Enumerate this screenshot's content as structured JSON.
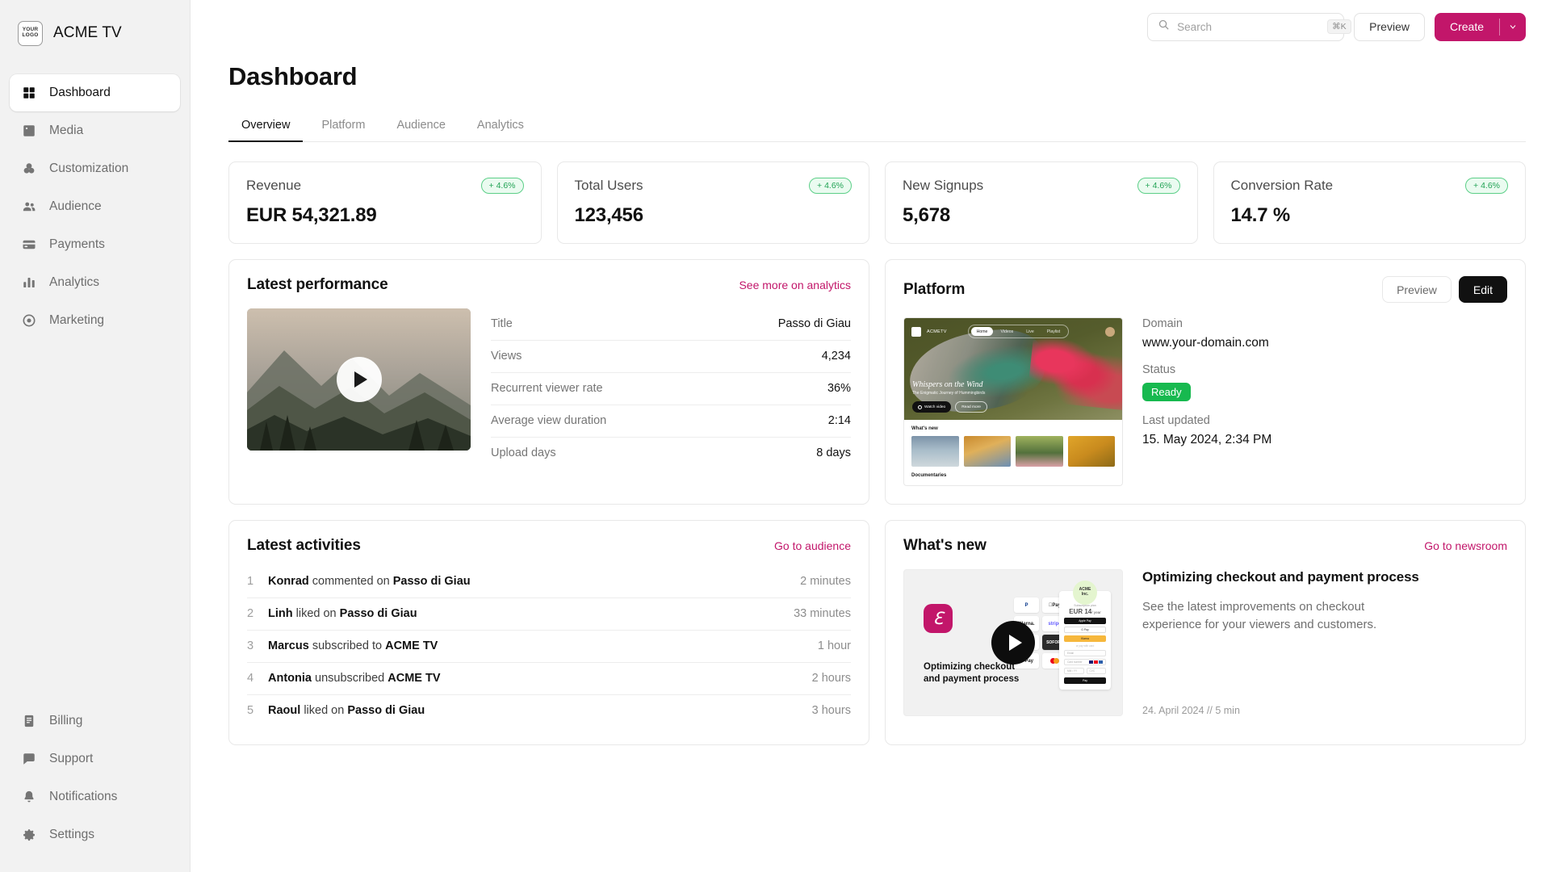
{
  "brand": {
    "logo_line1": "YOUR",
    "logo_line2": "LOGO",
    "name": "ACME TV"
  },
  "sidebar": {
    "primary": [
      {
        "label": "Dashboard",
        "icon": "grid-icon",
        "active": true
      },
      {
        "label": "Media",
        "icon": "image-icon",
        "active": false
      },
      {
        "label": "Customization",
        "icon": "palette-icon",
        "active": false
      },
      {
        "label": "Audience",
        "icon": "people-icon",
        "active": false
      },
      {
        "label": "Payments",
        "icon": "credit-card-icon",
        "active": false
      },
      {
        "label": "Analytics",
        "icon": "bar-chart-icon",
        "active": false
      },
      {
        "label": "Marketing",
        "icon": "target-icon",
        "active": false
      }
    ],
    "secondary": [
      {
        "label": "Billing",
        "icon": "document-icon"
      },
      {
        "label": "Support",
        "icon": "chat-icon"
      },
      {
        "label": "Notifications",
        "icon": "bell-icon"
      },
      {
        "label": "Settings",
        "icon": "gear-icon"
      }
    ]
  },
  "topbar": {
    "search_placeholder": "Search",
    "search_value": "",
    "search_shortcut": "⌘K",
    "preview_label": "Preview",
    "create_label": "Create"
  },
  "page": {
    "title": "Dashboard"
  },
  "tabs": [
    {
      "label": "Overview",
      "active": true
    },
    {
      "label": "Platform",
      "active": false
    },
    {
      "label": "Audience",
      "active": false
    },
    {
      "label": "Analytics",
      "active": false
    }
  ],
  "kpis": [
    {
      "label": "Revenue",
      "value": "EUR 54,321.89",
      "delta": "+ 4.6%"
    },
    {
      "label": "Total Users",
      "value": "123,456",
      "delta": "+ 4.6%"
    },
    {
      "label": "New Signups",
      "value": "5,678",
      "delta": "+ 4.6%"
    },
    {
      "label": "Conversion Rate",
      "value": "14.7 %",
      "delta": "+ 4.6%"
    }
  ],
  "latest_performance": {
    "title": "Latest performance",
    "link": "See more on analytics",
    "stats": [
      {
        "key": "Title",
        "value": "Passo di Giau"
      },
      {
        "key": "Views",
        "value": "4,234"
      },
      {
        "key": "Recurrent viewer rate",
        "value": "36%"
      },
      {
        "key": "Average view duration",
        "value": "2:14"
      },
      {
        "key": "Upload days",
        "value": "8 days"
      }
    ]
  },
  "platform": {
    "title": "Platform",
    "preview_label": "Preview",
    "edit_label": "Edit",
    "site": {
      "brand": "ACMETV",
      "nav": [
        "Home",
        "Videos",
        "Live",
        "Playlist"
      ],
      "hero_title": "Whispers on the Wind",
      "hero_subtitle": "The Enigmatic Journey of Hummingbirds",
      "hero_btn_primary": "Watch video",
      "hero_btn_secondary": "Read more",
      "section1": "What's new",
      "section2": "Documentaries"
    },
    "domain_label": "Domain",
    "domain_value": "www.your-domain.com",
    "status_label": "Status",
    "status_value": "Ready",
    "updated_label": "Last updated",
    "updated_value": "15. May 2024, 2:34 PM"
  },
  "activities": {
    "title": "Latest activities",
    "link": "Go to audience",
    "items": [
      {
        "index": "1",
        "actor": "Konrad",
        "verb": "commented on",
        "target": "Passo di Giau",
        "time": "2 minutes"
      },
      {
        "index": "2",
        "actor": "Linh",
        "verb": "liked on",
        "target": "Passo di Giau",
        "time": "33 minutes"
      },
      {
        "index": "3",
        "actor": "Marcus",
        "verb": "subscribed to",
        "target": "ACME TV",
        "time": "1 hour"
      },
      {
        "index": "4",
        "actor": "Antonia",
        "verb": "unsubscribed",
        "target": "ACME TV",
        "time": "2 hours"
      },
      {
        "index": "5",
        "actor": "Raoul",
        "verb": "liked on",
        "target": "Passo di Giau",
        "time": "3 hours"
      }
    ]
  },
  "whats_new": {
    "title": "What's new",
    "link": "Go to newsroom",
    "thumb_caption": "Optimizing checkout and payment process",
    "chips": [
      "PayPal",
      "Apple Pay",
      "Klarna.",
      "stripe",
      "SOFORT",
      "G Pay",
      "mastercard"
    ],
    "invoice": {
      "badge_line1": "ACME",
      "badge_line2": "Inc.",
      "plan_label": "Subscription plan",
      "price": "EUR 14",
      "period": "/ year",
      "btn_apple": "Apple Pay",
      "btn_g": "G Pay",
      "btn_klarna": "Klarna",
      "separator": "or pay with card",
      "field_email": "Email",
      "field_card": "Card number",
      "field_exp": "MM / YY",
      "field_cvc": "CVC",
      "btn_pay": "Pay"
    },
    "article_title": "Optimizing checkout and payment process",
    "article_desc": "See the latest improvements on checkout experience for your viewers and customers.",
    "article_meta": "24. April 2024 // 5 min"
  },
  "colors": {
    "accent": "#c2166a",
    "success": "#17b94f",
    "badge_green": "#22a355",
    "dark": "#111111"
  }
}
